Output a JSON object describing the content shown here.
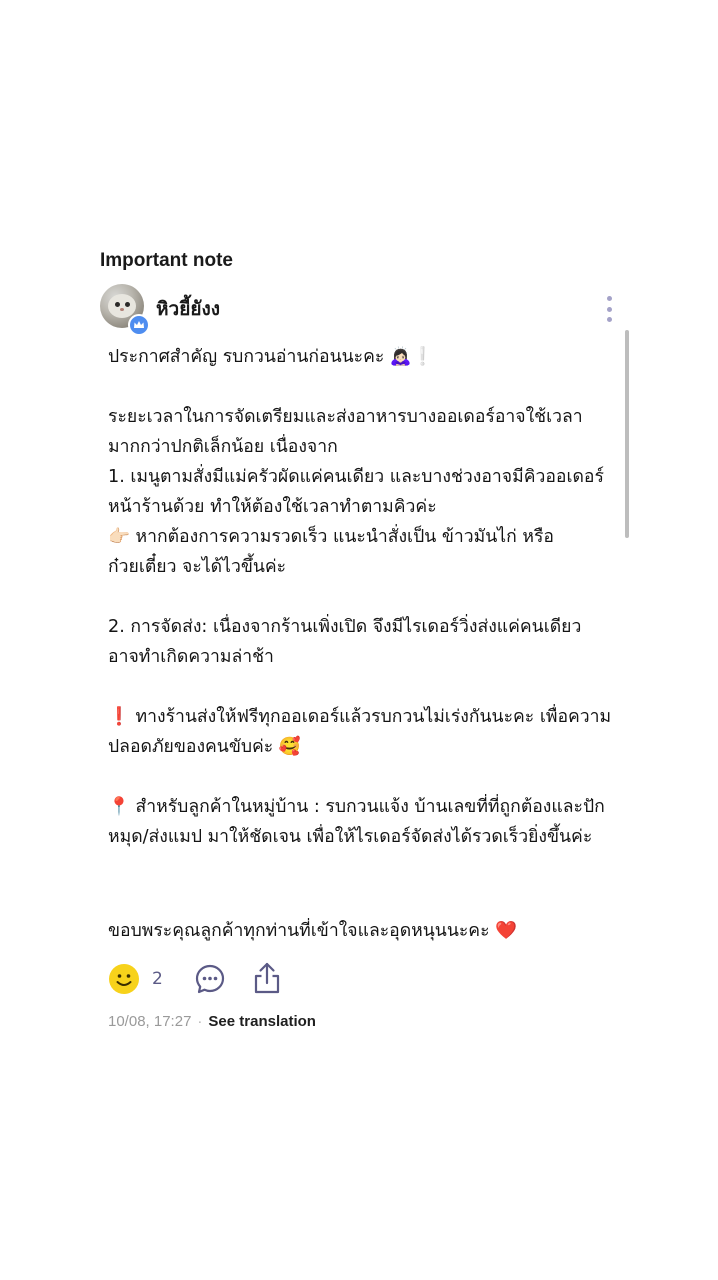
{
  "section": {
    "title": "Important note"
  },
  "author": {
    "name": "หิวยี้ยังง"
  },
  "post": {
    "lines": {
      "p1": "ประกาศสำคัญ รบกวนอ่านก่อนนะคะ 🙇🏻‍♀️❕",
      "p2": "ระยะเวลาในการจัดเตรียมและส่งอาหารบางออเดอร์อาจใช้เวลามากกว่าปกติเล็กน้อย เนื่องจาก",
      "p3": "1. เมนูตามสั่งมีแม่ครัวผัดแค่คนเดียว และบางช่วงอาจมีคิวออเดอร์หน้าร้านด้วย ทำให้ต้องใช้เวลาทำตามคิวค่ะ",
      "p4": "👉🏻 หากต้องการความรวดเร็ว แนะนำสั่งเป็น ข้าวมันไก่ หรือ ก๋วยเตี๋ยว จะได้ไวขึ้นค่ะ",
      "p5": "2. การจัดส่ง: เนื่องจากร้านเพิ่งเปิด จึงมีไรเดอร์วิ่งส่งแค่คนเดียว อาจทำเกิดความล่าช้า",
      "p6": "❗️ ทางร้านส่งให้ฟรีทุกออเดอร์แล้วรบกวนไม่เร่งกันนะคะ เพื่อความปลอดภัยของคนขับค่ะ 🥰",
      "p7": "📍 สำหรับลูกค้าในหมู่บ้าน : รบกวนแจ้ง บ้านเลขที่ที่ถูกต้องและปักหมุด/ส่งแมป มาให้ชัดเจน เพื่อให้ไรเดอร์จัดส่งได้รวดเร็วยิ่งขึ้นค่ะ",
      "p8": "ขอบพระคุณลูกค้าทุกท่านที่เข้าใจและอุดหนุนนะคะ ❤️"
    }
  },
  "actions": {
    "reaction_count": "2",
    "icons": [
      "smile-icon",
      "comment-icon",
      "share-icon",
      "more-icon"
    ]
  },
  "meta": {
    "timestamp": "10/08, 17:27",
    "separator": "·",
    "translate_label": "See translation"
  },
  "colors": {
    "accent_icon": "#5b5a86",
    "badge": "#4e8df0",
    "smile": "#f7d21b",
    "muted": "#9a9a9a"
  }
}
